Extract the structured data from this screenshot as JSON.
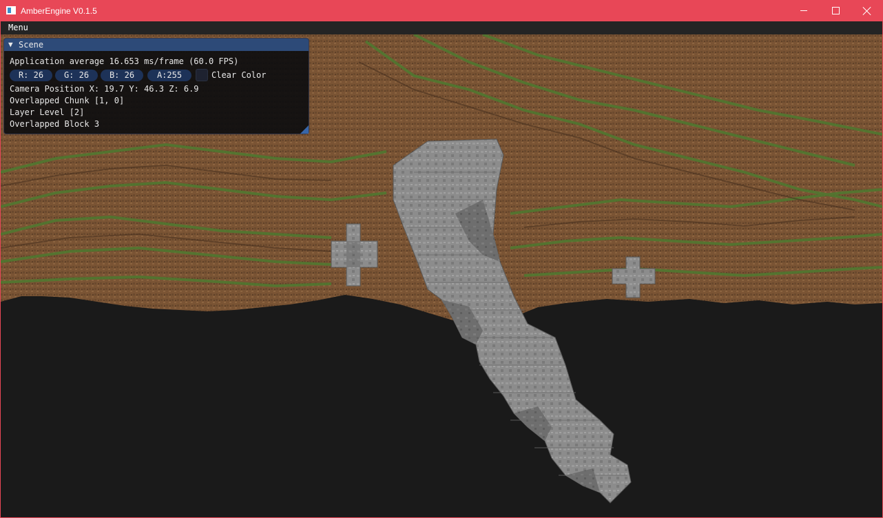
{
  "window": {
    "title": "AmberEngine V0.1.5",
    "accent_color": "#e84757",
    "controls": {
      "minimize_icon": "minimize-icon",
      "maximize_icon": "maximize-icon",
      "close_icon": "close-icon"
    }
  },
  "menubar": {
    "items": [
      {
        "label": "Menu"
      }
    ]
  },
  "scene_panel": {
    "title": "Scene",
    "collapse_icon": "▼",
    "fps_text": "Application average 16.653 ms/frame (60.0 FPS)",
    "clear_color": {
      "r_label": "R: 26",
      "g_label": "G: 26",
      "b_label": "B: 26",
      "a_label": "A:255",
      "checkbox_label": "Clear Color",
      "checked": false
    },
    "camera_position": "Camera Position X: 19.7 Y: 46.3 Z: 6.9",
    "overlapped_chunk": "Overlapped Chunk [1, 0]",
    "layer_level": "Layer Level [2]",
    "overlapped_block": "Overlapped Block 3"
  },
  "scene": {
    "clear_color_hex": "#1a1a1a",
    "terrain_colors": {
      "dirt": "#7a5434",
      "grass": "#4e7a30",
      "stone": "#8a8a8a"
    }
  }
}
